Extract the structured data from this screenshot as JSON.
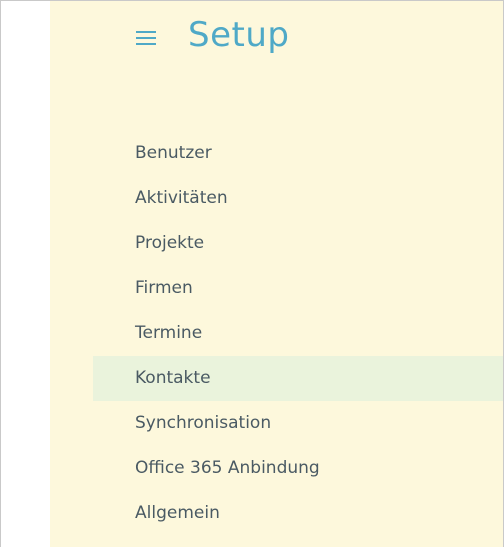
{
  "header": {
    "menu_icon": "hamburger-menu-icon",
    "title": "Setup"
  },
  "menu": {
    "items": [
      {
        "label": "Benutzer"
      },
      {
        "label": "Aktivitäten"
      },
      {
        "label": "Projekte"
      },
      {
        "label": "Firmen"
      },
      {
        "label": "Termine"
      },
      {
        "label": "Kontakte",
        "active": true
      },
      {
        "label": "Synchronisation"
      },
      {
        "label": "Office 365 Anbindung"
      },
      {
        "label": "Allgemein"
      }
    ]
  },
  "colors": {
    "panel_background": "#fdf8dc",
    "title": "#4fa9c7",
    "menu_text": "#4a5a63",
    "active_background": "#eaf3dc",
    "frame_border": "#c9c9c9"
  }
}
